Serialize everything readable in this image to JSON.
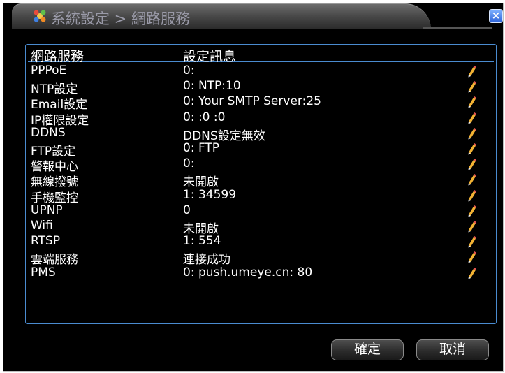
{
  "window": {
    "title": "系統設定 > 網路服務",
    "close_label": "×"
  },
  "table": {
    "headers": [
      "網路服務",
      "設定訊息"
    ],
    "rows": [
      {
        "name": "PPPoE",
        "value": "0:"
      },
      {
        "name": "NTP設定",
        "value": "0: NTP:10"
      },
      {
        "name": "Email設定",
        "value": "0: Your SMTP Server:25"
      },
      {
        "name": "IP權限設定",
        "value": "0: :0 :0"
      },
      {
        "name": "DDNS",
        "value": "DDNS設定無效"
      },
      {
        "name": "FTP設定",
        "value": "0: FTP"
      },
      {
        "name": "警報中心",
        "value": "0:"
      },
      {
        "name": "無線撥號",
        "value": "未開啟"
      },
      {
        "name": "手機監控",
        "value": "1: 34599"
      },
      {
        "name": "UPNP",
        "value": "0"
      },
      {
        "name": "Wifi",
        "value": "未開啟"
      },
      {
        "name": "RTSP",
        "value": "1: 554"
      },
      {
        "name": "雲端服務",
        "value": "連接成功"
      },
      {
        "name": "PMS",
        "value": "0: push.umeye.cn: 80"
      }
    ],
    "edit_icon": "pencil-icon"
  },
  "buttons": {
    "ok_label": "確定",
    "cancel_label": "取消"
  },
  "colors": {
    "background": "#000000",
    "panel_border": "#4a8bd0",
    "text": "#ffffff",
    "close_button": "#2d63d8"
  }
}
